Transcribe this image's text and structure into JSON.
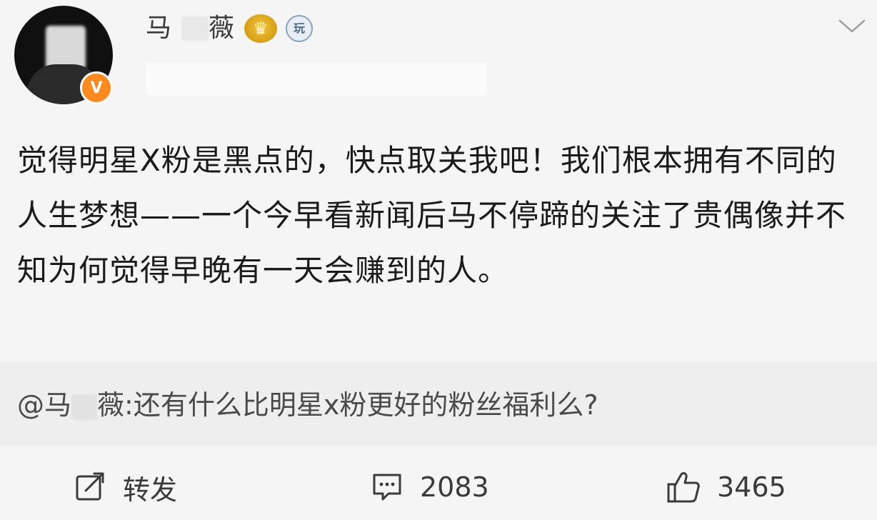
{
  "author": {
    "name_prefix": "马",
    "name_suffix": "薇",
    "verified_badge": "V",
    "level_badge": "玩",
    "icons": [
      "crown-icon",
      "level-icon",
      "verified-icon",
      "chevron-down-icon"
    ]
  },
  "post": {
    "text": "觉得明星X粉是黑点的，快点取关我吧！我们根本拥有不同的人生梦想——一个今早看新闻后马不停蹄的关注了贵偶像并不知为何觉得早晚有一天会赚到的人。"
  },
  "quote": {
    "mention_prefix": "@马",
    "mention_suffix": "薇",
    "text": ":还有什么比明星x粉更好的粉丝福利么?"
  },
  "actions": {
    "repost_label": "转发",
    "comment_count": "2083",
    "like_count": "3465"
  },
  "colors": {
    "background": "#f5f5f5",
    "quote_background": "#eeeeee",
    "verified_orange": "#ff8a1f",
    "crown_gold": "#d89d17"
  }
}
